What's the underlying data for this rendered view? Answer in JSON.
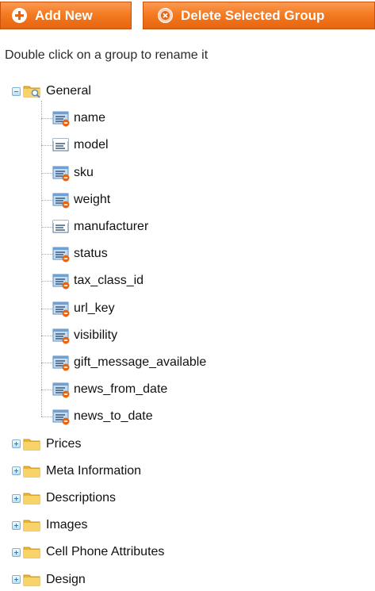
{
  "toolbar": {
    "add_label": "Add New",
    "delete_label": "Delete Selected Group"
  },
  "hint": "Double click on a group to rename it",
  "tree": {
    "general": {
      "label": "General",
      "expanded": true,
      "attributes": [
        {
          "label": "name",
          "icon": "attribute-required-icon"
        },
        {
          "label": "model",
          "icon": "attribute-icon"
        },
        {
          "label": "sku",
          "icon": "attribute-required-icon"
        },
        {
          "label": "weight",
          "icon": "attribute-required-icon"
        },
        {
          "label": "manufacturer",
          "icon": "attribute-icon"
        },
        {
          "label": "status",
          "icon": "attribute-required-icon"
        },
        {
          "label": "tax_class_id",
          "icon": "attribute-required-icon"
        },
        {
          "label": "url_key",
          "icon": "attribute-required-icon"
        },
        {
          "label": "visibility",
          "icon": "attribute-required-icon"
        },
        {
          "label": "gift_message_available",
          "icon": "attribute-required-icon"
        },
        {
          "label": "news_from_date",
          "icon": "attribute-required-icon"
        },
        {
          "label": "news_to_date",
          "icon": "attribute-required-icon"
        }
      ]
    },
    "groups": [
      {
        "label": "Prices",
        "expanded": false
      },
      {
        "label": "Meta Information",
        "expanded": false
      },
      {
        "label": "Descriptions",
        "expanded": false
      },
      {
        "label": "Images",
        "expanded": false
      },
      {
        "label": "Cell Phone Attributes",
        "expanded": false
      },
      {
        "label": "Design",
        "expanded": false
      }
    ]
  },
  "colors": {
    "button": "#f3781e",
    "button_border": "#c9530d",
    "folder": "#f5c74a",
    "expander": "#7fb1d6",
    "required_dot": "#e8650f"
  }
}
